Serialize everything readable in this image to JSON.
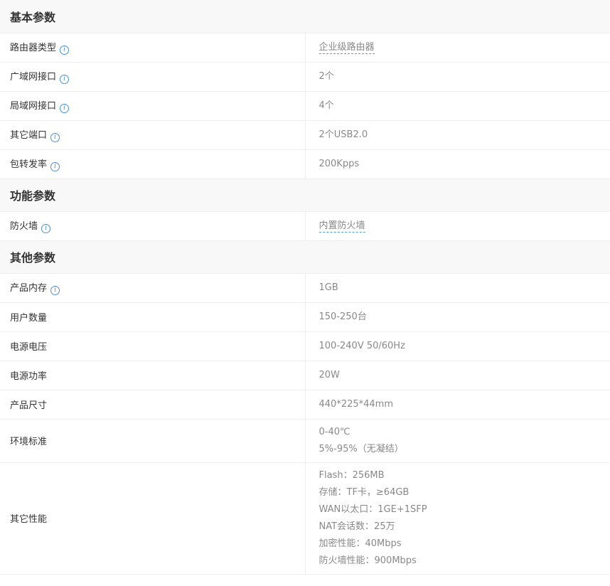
{
  "sections": [
    {
      "title": "基本参数",
      "rows": [
        {
          "name": "路由器类型",
          "info": true,
          "link": true,
          "values": [
            "企业级路由器"
          ]
        },
        {
          "name": "广域网接口",
          "info": true,
          "values": [
            "2个"
          ]
        },
        {
          "name": "局域网接口",
          "info": true,
          "values": [
            "4个"
          ]
        },
        {
          "name": "其它端口",
          "info": true,
          "values": [
            "2个USB2.0"
          ]
        },
        {
          "name": "包转发率",
          "info": true,
          "values": [
            "200Kpps"
          ]
        }
      ]
    },
    {
      "title": "功能参数",
      "rows": [
        {
          "name": "防火墙",
          "info": true,
          "link": true,
          "values": [
            "内置防火墙"
          ]
        }
      ]
    },
    {
      "title": "其他参数",
      "rows": [
        {
          "name": "产品内存",
          "info": true,
          "values": [
            "1GB"
          ]
        },
        {
          "name": "用户数量",
          "values": [
            "150-250台"
          ]
        },
        {
          "name": "电源电压",
          "values": [
            "100-240V 50/60Hz"
          ]
        },
        {
          "name": "电源功率",
          "values": [
            "20W"
          ]
        },
        {
          "name": "产品尺寸",
          "values": [
            "440*225*44mm"
          ]
        },
        {
          "name": "环境标准",
          "values": [
            "0-40℃",
            "5%-95%（无凝结）"
          ]
        },
        {
          "name": "其它性能",
          "values": [
            "Flash：256MB",
            "存储：TF卡，≥64GB",
            "WAN以太口：1GE+1SFP",
            "NAT会话数：25万",
            "加密性能：40Mbps",
            "防火墙性能：900Mbps"
          ]
        }
      ]
    }
  ],
  "icons": {
    "info": "i"
  },
  "colors": {
    "info_icon": "#4a90e2",
    "link_underline": "#4aa3df",
    "section_bg": "#f8f8f8"
  }
}
